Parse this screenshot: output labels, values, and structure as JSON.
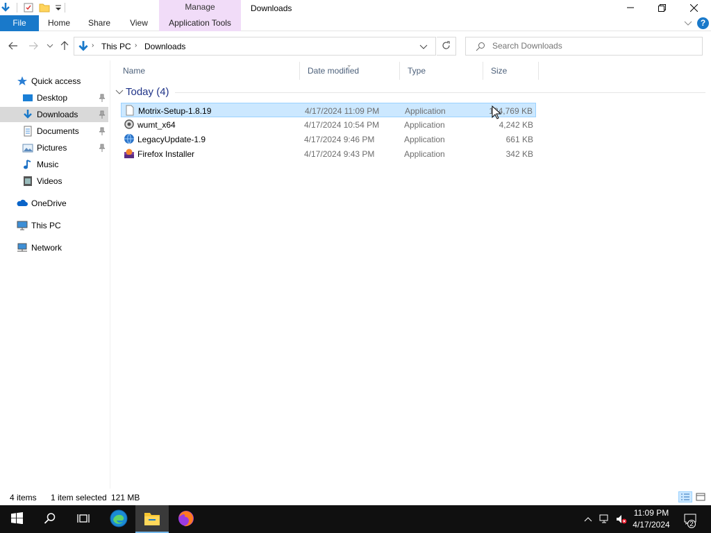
{
  "window": {
    "title": "Downloads",
    "context_tab": "Manage",
    "colors": {
      "file_tab": "#1979ca",
      "manage_tab": "#f1dcf8",
      "selection": "#cce8ff",
      "selection_border": "#99d1ff",
      "group_text": "#1e3287"
    }
  },
  "ribbon": {
    "tabs": [
      {
        "label": "File"
      },
      {
        "label": "Home"
      },
      {
        "label": "Share"
      },
      {
        "label": "View"
      },
      {
        "label": "Application Tools"
      }
    ],
    "help": "?"
  },
  "address": {
    "crumbs": [
      "This PC",
      "Downloads"
    ],
    "search_placeholder": "Search Downloads"
  },
  "navpane": {
    "items": [
      {
        "label": "Quick access",
        "icon": "star-icon"
      },
      {
        "label": "Desktop",
        "icon": "desktop-icon",
        "pinned": true
      },
      {
        "label": "Downloads",
        "icon": "download-arrow-icon",
        "pinned": true,
        "selected": true
      },
      {
        "label": "Documents",
        "icon": "documents-icon",
        "pinned": true
      },
      {
        "label": "Pictures",
        "icon": "pictures-icon",
        "pinned": true
      },
      {
        "label": "Music",
        "icon": "music-icon"
      },
      {
        "label": "Videos",
        "icon": "videos-icon"
      },
      {
        "label": "OneDrive",
        "icon": "cloud-icon"
      },
      {
        "label": "This PC",
        "icon": "computer-icon"
      },
      {
        "label": "Network",
        "icon": "network-icon"
      }
    ]
  },
  "filelist": {
    "columns": [
      "Name",
      "Date modified",
      "Type",
      "Size"
    ],
    "group": "Today (4)",
    "rows": [
      {
        "name": "Motrix-Setup-1.8.19",
        "date": "4/17/2024 11:09 PM",
        "type": "Application",
        "size": "124,769 KB",
        "selected": true,
        "icon": "blank-file-icon"
      },
      {
        "name": "wumt_x64",
        "date": "4/17/2024 10:54 PM",
        "type": "Application",
        "size": "4,242 KB",
        "icon": "update-gear-icon"
      },
      {
        "name": "LegacyUpdate-1.9",
        "date": "4/17/2024 9:46 PM",
        "type": "Application",
        "size": "661 KB",
        "icon": "globe-update-icon"
      },
      {
        "name": "Firefox Installer",
        "date": "4/17/2024 9:43 PM",
        "type": "Application",
        "size": "342 KB",
        "icon": "installer-icon"
      }
    ]
  },
  "status": {
    "item_count": "4 items",
    "selected": "1 item selected",
    "selected_size": "121 MB"
  },
  "taskbar": {
    "apps": [
      "start-icon",
      "search-icon",
      "task-view-icon",
      "edge-icon",
      "file-explorer-icon",
      "firefox-icon"
    ],
    "clock_time": "11:09 PM",
    "clock_date": "4/17/2024",
    "notification_count": "2"
  }
}
